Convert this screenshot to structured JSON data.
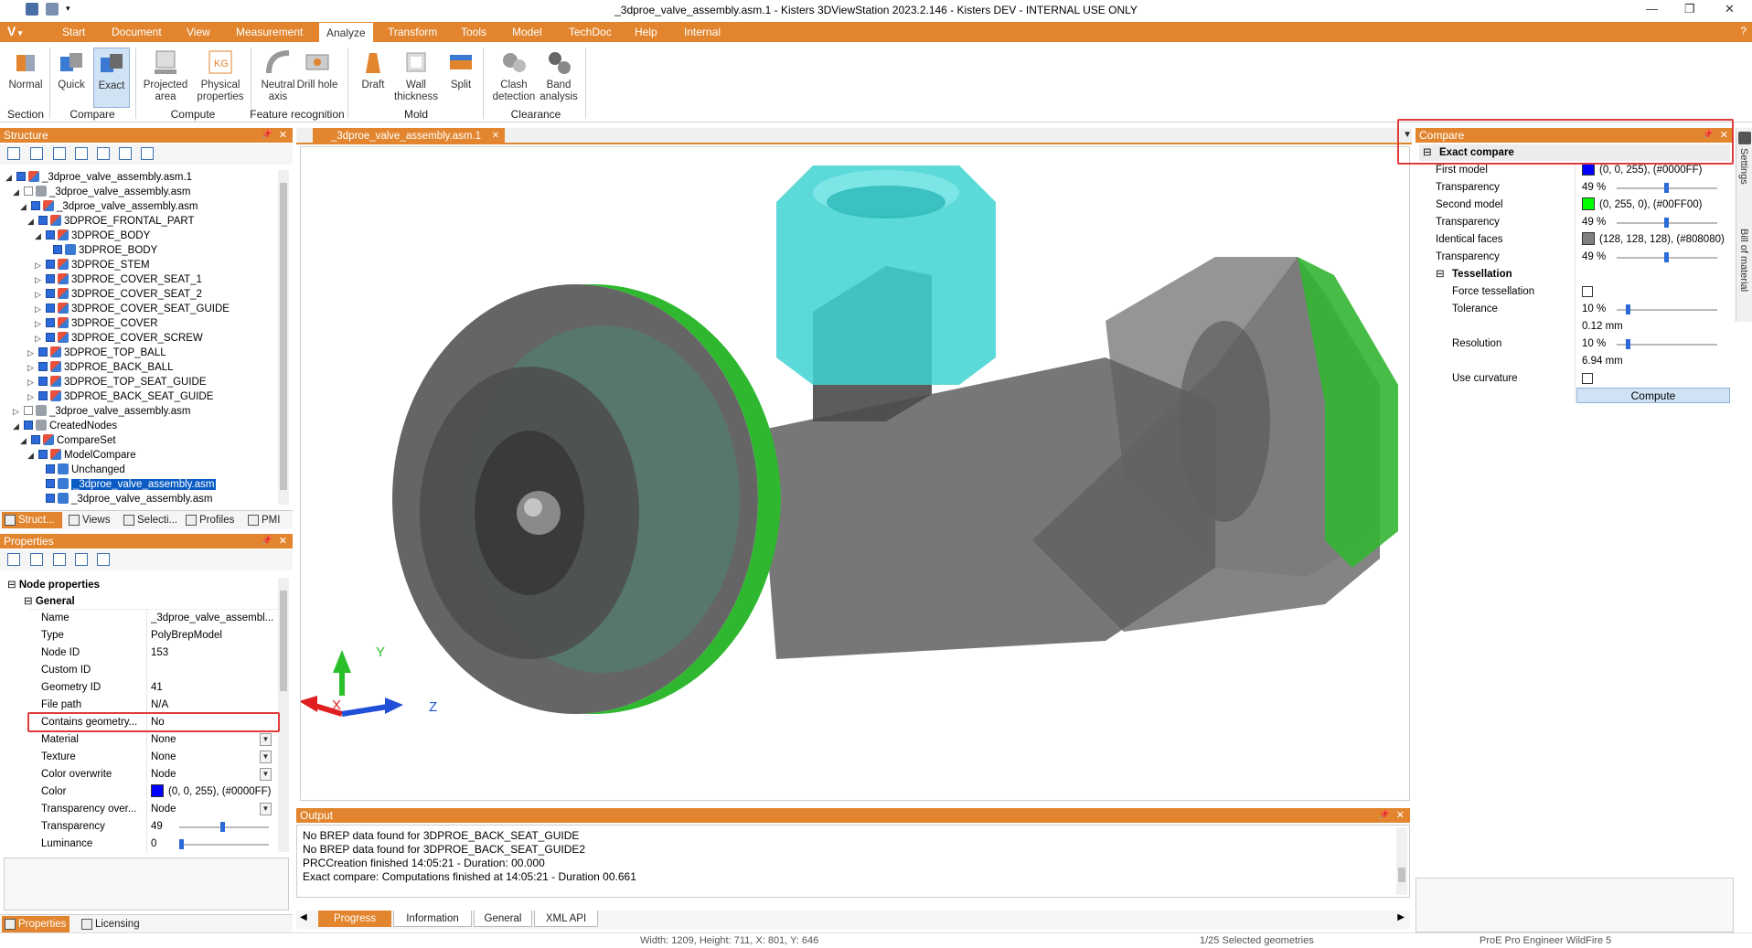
{
  "window": {
    "title": "_3dproe_valve_assembly.asm.1 - Kisters 3DViewStation 2023.2.146 - Kisters DEV - INTERNAL USE ONLY",
    "minimize": "—",
    "restore": "❐",
    "close": "✕"
  },
  "menu": {
    "logo": "V",
    "tabs": [
      "Start",
      "Document",
      "View",
      "Measurement",
      "Analyze",
      "Transform",
      "Tools",
      "Model",
      "TechDoc",
      "Help",
      "Internal"
    ],
    "active": "Analyze"
  },
  "ribbon": {
    "buttons": {
      "normal": "Normal",
      "quick": "Quick",
      "exact": "Exact",
      "projected_area": "Projected area",
      "physical_properties": "Physical properties",
      "neutral_axis": "Neutral axis",
      "drill_hole": "Drill hole",
      "draft": "Draft",
      "wall_thickness": "Wall thickness",
      "split": "Split",
      "clash_detection": "Clash detection",
      "band_analysis": "Band analysis"
    },
    "groups": {
      "section": "Section",
      "compare": "Compare",
      "compute": "Compute",
      "feature_recognition": "Feature recognition",
      "mold": "Mold",
      "clearance": "Clearance"
    }
  },
  "structure": {
    "title": "Structure",
    "rows": [
      "_3dproe_valve_assembly.asm.1",
      "_3dproe_valve_assembly.asm",
      "_3dproe_valve_assembly.asm",
      "3DPROE_FRONTAL_PART",
      "3DPROE_BODY",
      "3DPROE_BODY",
      "3DPROE_STEM",
      "3DPROE_COVER_SEAT_1",
      "3DPROE_COVER_SEAT_2",
      "3DPROE_COVER_SEAT_GUIDE",
      "3DPROE_COVER",
      "3DPROE_COVER_SCREW",
      "3DPROE_TOP_BALL",
      "3DPROE_BACK_BALL",
      "3DPROE_TOP_SEAT_GUIDE",
      "3DPROE_BACK_SEAT_GUIDE",
      "_3dproe_valve_assembly.asm",
      "CreatedNodes",
      "CompareSet",
      "ModelCompare",
      "Unchanged",
      "_3dproe_valve_assembly.asm",
      "_3dproe_valve_assembly.asm"
    ],
    "tabs": [
      "Struct...",
      "Views",
      "Selecti...",
      "Profiles",
      "PMI"
    ]
  },
  "properties": {
    "title": "Properties",
    "section": "Node properties",
    "group": "General",
    "rows": [
      {
        "k": "Name",
        "v": "_3dproe_valve_assembl..."
      },
      {
        "k": "Type",
        "v": "PolyBrepModel"
      },
      {
        "k": "Node ID",
        "v": "153"
      },
      {
        "k": "Custom ID",
        "v": ""
      },
      {
        "k": "Geometry ID",
        "v": "41"
      },
      {
        "k": "File path",
        "v": "N/A"
      },
      {
        "k": "Contains geometry...",
        "v": "No"
      },
      {
        "k": "Material",
        "v": "None"
      },
      {
        "k": "Texture",
        "v": "None"
      },
      {
        "k": "Color overwrite",
        "v": "Node"
      },
      {
        "k": "Color",
        "v": "(0, 0, 255), (#0000FF)"
      },
      {
        "k": "Transparency over...",
        "v": "Node"
      },
      {
        "k": "Transparency",
        "v": "49"
      },
      {
        "k": "Luminance",
        "v": "0"
      }
    ],
    "tabs": [
      "Properties",
      "Licensing"
    ]
  },
  "viewport": {
    "doc_tab": "_3dproe_valve_assembly.asm.1",
    "axes": {
      "x": "X",
      "y": "Y",
      "z": "Z"
    }
  },
  "output": {
    "title": "Output",
    "lines": [
      "No BREP data found for 3DPROE_BACK_SEAT_GUIDE",
      "No BREP data found for 3DPROE_BACK_SEAT_GUIDE2",
      "PRCCreation finished 14:05:21 - Duration: 00.000",
      "Exact compare: Computations finished at 14:05:21 - Duration 00.661"
    ],
    "tabs": [
      "Progress",
      "Information",
      "General",
      "XML API"
    ]
  },
  "compare": {
    "title": "Compare",
    "section": "Exact compare",
    "first_model_label": "First model",
    "first_model_value": "(0, 0, 255), (#0000FF)",
    "transparency_label": "Transparency",
    "t1": "49 %",
    "second_model_label": "Second model",
    "second_model_value": "(0, 255, 0), (#00FF00)",
    "t2": "49 %",
    "identical_label": "Identical faces",
    "identical_value": "(128, 128, 128), (#808080)",
    "t3": "49 %",
    "tessellation": "Tessellation",
    "force_tess": "Force tessellation",
    "tolerance": "Tolerance",
    "tol_pct": "10 %",
    "tol_mm": "0.12 mm",
    "resolution": "Resolution",
    "res_pct": "10 %",
    "res_mm": "6.94 mm",
    "use_curvature": "Use curvature",
    "compute_btn": "Compute",
    "colors": {
      "first": "#0000FF",
      "second": "#00FF00",
      "identical": "#808080"
    }
  },
  "side_tabs": [
    "Settings",
    "Bill of material"
  ],
  "status": {
    "dims": "Width: 1209, Height: 711, X: 801, Y: 646",
    "selected": "1/25 Selected geometries",
    "format": "ProE Pro Engineer WildFire 5"
  }
}
